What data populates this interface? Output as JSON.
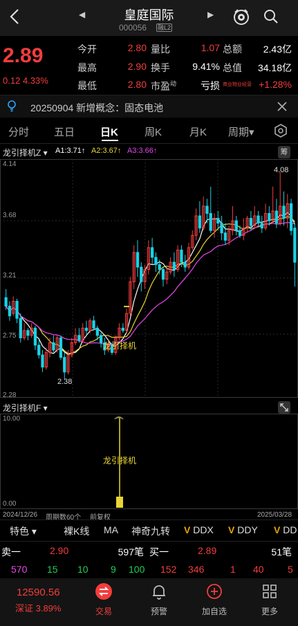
{
  "header": {
    "stock_name": "皇庭国际",
    "stock_code": "000056",
    "code_badge": "融L2"
  },
  "quote": {
    "price": "2.89",
    "change": "0.12",
    "change_pct": "4.33%",
    "rows": [
      {
        "label1": "今开",
        "value1": "2.80",
        "label2": "量比",
        "value2": "1.07",
        "label3": "总额",
        "value3": "2.43亿"
      },
      {
        "label1": "最高",
        "value1": "2.90",
        "label2": "换手",
        "value2": "9.41%",
        "label3": "总值",
        "value3": "34.18亿"
      },
      {
        "label1": "最低",
        "value1": "2.80",
        "label2": "市盈",
        "label2_sup": "动",
        "value2": "亏损",
        "label3": "商业物业经营",
        "value3": "+1.28%"
      }
    ]
  },
  "concept": {
    "text": "20250904 新增概念：固态电池"
  },
  "tabs": [
    "分时",
    "五日",
    "日K",
    "周K",
    "月K",
    "周期▾"
  ],
  "indicator": {
    "name": "龙引择机Z ▾",
    "a1": "A1:3.71↑",
    "a2": "A2:3.67↑",
    "a3": "A3:3.66↑",
    "chip_label": "筹"
  },
  "chart": {
    "y_labels": [
      "4.14",
      "3.68",
      "3.21",
      "2.75",
      "2.28"
    ],
    "high_label": "4.08",
    "low_label": "2.38",
    "signal_label": "龙引择机"
  },
  "chart_data": {
    "type": "candlestick",
    "ylim": [
      2.28,
      4.14
    ],
    "candles": [
      {
        "o": 3.05,
        "c": 2.98,
        "h": 3.12,
        "l": 2.95
      },
      {
        "o": 2.98,
        "c": 2.9,
        "h": 3.02,
        "l": 2.86
      },
      {
        "o": 2.92,
        "c": 3.02,
        "h": 3.06,
        "l": 2.9
      },
      {
        "o": 3.02,
        "c": 2.88,
        "h": 3.04,
        "l": 2.84
      },
      {
        "o": 2.88,
        "c": 2.72,
        "h": 2.92,
        "l": 2.68
      },
      {
        "o": 2.72,
        "c": 2.78,
        "h": 2.84,
        "l": 2.7
      },
      {
        "o": 2.78,
        "c": 2.74,
        "h": 2.8,
        "l": 2.7
      },
      {
        "o": 2.74,
        "c": 2.8,
        "h": 2.84,
        "l": 2.72
      },
      {
        "o": 2.8,
        "c": 2.66,
        "h": 2.82,
        "l": 2.62
      },
      {
        "o": 2.66,
        "c": 2.58,
        "h": 2.7,
        "l": 2.55
      },
      {
        "o": 2.58,
        "c": 2.48,
        "h": 2.62,
        "l": 2.44
      },
      {
        "o": 2.48,
        "c": 2.6,
        "h": 2.64,
        "l": 2.46
      },
      {
        "o": 2.6,
        "c": 2.68,
        "h": 2.72,
        "l": 2.56
      },
      {
        "o": 2.68,
        "c": 2.62,
        "h": 2.74,
        "l": 2.6
      },
      {
        "o": 2.62,
        "c": 2.72,
        "h": 2.74,
        "l": 2.6
      },
      {
        "o": 2.72,
        "c": 2.56,
        "h": 2.74,
        "l": 2.54
      },
      {
        "o": 2.56,
        "c": 2.44,
        "h": 2.6,
        "l": 2.38
      },
      {
        "o": 2.44,
        "c": 2.58,
        "h": 2.62,
        "l": 2.42
      },
      {
        "o": 2.58,
        "c": 2.68,
        "h": 2.72,
        "l": 2.56
      },
      {
        "o": 2.68,
        "c": 2.74,
        "h": 2.8,
        "l": 2.66
      },
      {
        "o": 2.74,
        "c": 2.7,
        "h": 2.8,
        "l": 2.68
      },
      {
        "o": 2.7,
        "c": 2.8,
        "h": 2.84,
        "l": 2.68
      },
      {
        "o": 2.8,
        "c": 2.78,
        "h": 2.86,
        "l": 2.74
      },
      {
        "o": 2.78,
        "c": 2.86,
        "h": 2.88,
        "l": 2.76
      },
      {
        "o": 2.86,
        "c": 2.8,
        "h": 2.9,
        "l": 2.78
      },
      {
        "o": 2.8,
        "c": 2.74,
        "h": 2.82,
        "l": 2.7
      },
      {
        "o": 2.74,
        "c": 2.68,
        "h": 2.76,
        "l": 2.64
      },
      {
        "o": 2.68,
        "c": 2.62,
        "h": 2.72,
        "l": 2.58
      },
      {
        "o": 2.62,
        "c": 2.66,
        "h": 2.7,
        "l": 2.6
      },
      {
        "o": 2.66,
        "c": 2.6,
        "h": 2.68,
        "l": 2.58
      },
      {
        "o": 2.6,
        "c": 2.72,
        "h": 2.74,
        "l": 2.58
      },
      {
        "o": 2.72,
        "c": 2.8,
        "h": 2.84,
        "l": 2.7
      },
      {
        "o": 2.8,
        "c": 2.78,
        "h": 2.84,
        "l": 2.76
      },
      {
        "o": 2.78,
        "c": 2.92,
        "h": 2.96,
        "l": 2.76
      },
      {
        "o": 2.92,
        "c": 3.18,
        "h": 3.22,
        "l": 2.9
      },
      {
        "o": 3.18,
        "c": 3.42,
        "h": 3.48,
        "l": 3.12
      },
      {
        "o": 3.42,
        "c": 3.3,
        "h": 3.52,
        "l": 3.22
      },
      {
        "o": 3.3,
        "c": 3.18,
        "h": 3.34,
        "l": 3.1
      },
      {
        "o": 3.18,
        "c": 3.28,
        "h": 3.32,
        "l": 3.12
      },
      {
        "o": 3.28,
        "c": 3.46,
        "h": 3.52,
        "l": 3.24
      },
      {
        "o": 3.46,
        "c": 3.38,
        "h": 3.54,
        "l": 3.32
      },
      {
        "o": 3.38,
        "c": 3.32,
        "h": 3.42,
        "l": 3.26
      },
      {
        "o": 3.32,
        "c": 3.28,
        "h": 3.36,
        "l": 3.24
      },
      {
        "o": 3.28,
        "c": 3.2,
        "h": 3.3,
        "l": 3.14
      },
      {
        "o": 3.2,
        "c": 3.26,
        "h": 3.3,
        "l": 3.16
      },
      {
        "o": 3.26,
        "c": 3.34,
        "h": 3.38,
        "l": 3.24
      },
      {
        "o": 3.34,
        "c": 3.28,
        "h": 3.42,
        "l": 3.22
      },
      {
        "o": 3.28,
        "c": 3.44,
        "h": 3.48,
        "l": 3.26
      },
      {
        "o": 3.44,
        "c": 3.34,
        "h": 3.48,
        "l": 3.3
      },
      {
        "o": 3.34,
        "c": 3.3,
        "h": 3.4,
        "l": 3.26
      },
      {
        "o": 3.3,
        "c": 3.46,
        "h": 3.5,
        "l": 3.28
      },
      {
        "o": 3.46,
        "c": 3.56,
        "h": 3.6,
        "l": 3.44
      },
      {
        "o": 3.56,
        "c": 3.72,
        "h": 3.78,
        "l": 3.52
      },
      {
        "o": 3.72,
        "c": 3.62,
        "h": 3.84,
        "l": 3.58
      },
      {
        "o": 3.62,
        "c": 3.8,
        "h": 3.88,
        "l": 3.6
      },
      {
        "o": 3.8,
        "c": 3.74,
        "h": 3.86,
        "l": 3.66
      },
      {
        "o": 3.74,
        "c": 3.6,
        "h": 3.96,
        "l": 3.58
      },
      {
        "o": 3.6,
        "c": 3.7,
        "h": 3.74,
        "l": 3.54
      },
      {
        "o": 3.7,
        "c": 3.66,
        "h": 3.76,
        "l": 3.6
      },
      {
        "o": 3.66,
        "c": 3.58,
        "h": 3.72,
        "l": 3.52
      },
      {
        "o": 3.58,
        "c": 3.52,
        "h": 3.66,
        "l": 3.48
      },
      {
        "o": 3.52,
        "c": 3.6,
        "h": 3.64,
        "l": 3.48
      },
      {
        "o": 3.6,
        "c": 3.68,
        "h": 3.8,
        "l": 3.56
      },
      {
        "o": 3.68,
        "c": 3.6,
        "h": 3.72,
        "l": 3.56
      },
      {
        "o": 3.6,
        "c": 3.56,
        "h": 3.64,
        "l": 3.54
      },
      {
        "o": 3.56,
        "c": 3.62,
        "h": 3.7,
        "l": 3.52
      },
      {
        "o": 3.62,
        "c": 3.7,
        "h": 3.72,
        "l": 3.58
      },
      {
        "o": 3.7,
        "c": 3.64,
        "h": 3.76,
        "l": 3.6
      },
      {
        "o": 3.64,
        "c": 3.72,
        "h": 3.8,
        "l": 3.62
      },
      {
        "o": 3.72,
        "c": 3.66,
        "h": 3.76,
        "l": 3.64
      },
      {
        "o": 3.66,
        "c": 3.62,
        "h": 3.72,
        "l": 3.58
      },
      {
        "o": 3.62,
        "c": 3.74,
        "h": 3.82,
        "l": 3.6
      },
      {
        "o": 3.74,
        "c": 3.68,
        "h": 3.8,
        "l": 3.64
      },
      {
        "o": 3.68,
        "c": 3.76,
        "h": 3.96,
        "l": 3.66
      },
      {
        "o": 3.76,
        "c": 3.66,
        "h": 3.86,
        "l": 3.62
      },
      {
        "o": 3.66,
        "c": 3.8,
        "h": 4.08,
        "l": 3.64
      },
      {
        "o": 3.8,
        "c": 3.7,
        "h": 3.92,
        "l": 3.64
      },
      {
        "o": 3.7,
        "c": 3.82,
        "h": 3.9,
        "l": 3.62
      },
      {
        "o": 3.82,
        "c": 3.6,
        "h": 3.86,
        "l": 3.56
      },
      {
        "o": 3.62,
        "c": 3.34,
        "h": 3.66,
        "l": 3.14
      }
    ],
    "signal_index": 33
  },
  "subchart": {
    "name": "龙引择机F ▾",
    "y_top": "10.00",
    "y_bottom": "0.00",
    "signal_label": "龙引择机",
    "date_left": "2024/12/26",
    "period": "周期数60个",
    "adjust": "前复权",
    "date_right": "2025/03/28"
  },
  "indicator_tabs": [
    {
      "label": "特色 ▾",
      "v": false
    },
    {
      "label": "裸K线",
      "v": false
    },
    {
      "label": "MA",
      "v": false
    },
    {
      "label": "神奇九转",
      "v": false
    },
    {
      "label": "DDX",
      "v": true
    },
    {
      "label": "DDY",
      "v": true
    },
    {
      "label": "DD",
      "v": true
    }
  ],
  "orderbook": {
    "sell1_label": "卖一",
    "sell1_price": "2.90",
    "sell1_vol": "597笔",
    "buy1_label": "买一",
    "buy1_price": "2.89",
    "buy1_vol": "51笔",
    "sell_detail": [
      "570",
      "15",
      "10",
      "9",
      "100"
    ],
    "buy_detail": [
      "152",
      "346",
      "1",
      "40",
      "5"
    ]
  },
  "bottom": {
    "index_value": "12590.56",
    "index_name": "深证 3.89%",
    "nav": [
      {
        "label": "交易",
        "icon": "trade-icon",
        "active": true
      },
      {
        "label": "预警",
        "icon": "bell-icon",
        "active": false
      },
      {
        "label": "加自选",
        "icon": "plus-circle-icon",
        "active": false
      },
      {
        "label": "更多",
        "icon": "grid-icon",
        "active": false
      }
    ]
  },
  "colors": {
    "up": "#f23d3d",
    "down": "#19d3e6",
    "ma_white": "#ffffff",
    "ma_yellow": "#e8d534",
    "ma_pink": "#e548e8"
  }
}
